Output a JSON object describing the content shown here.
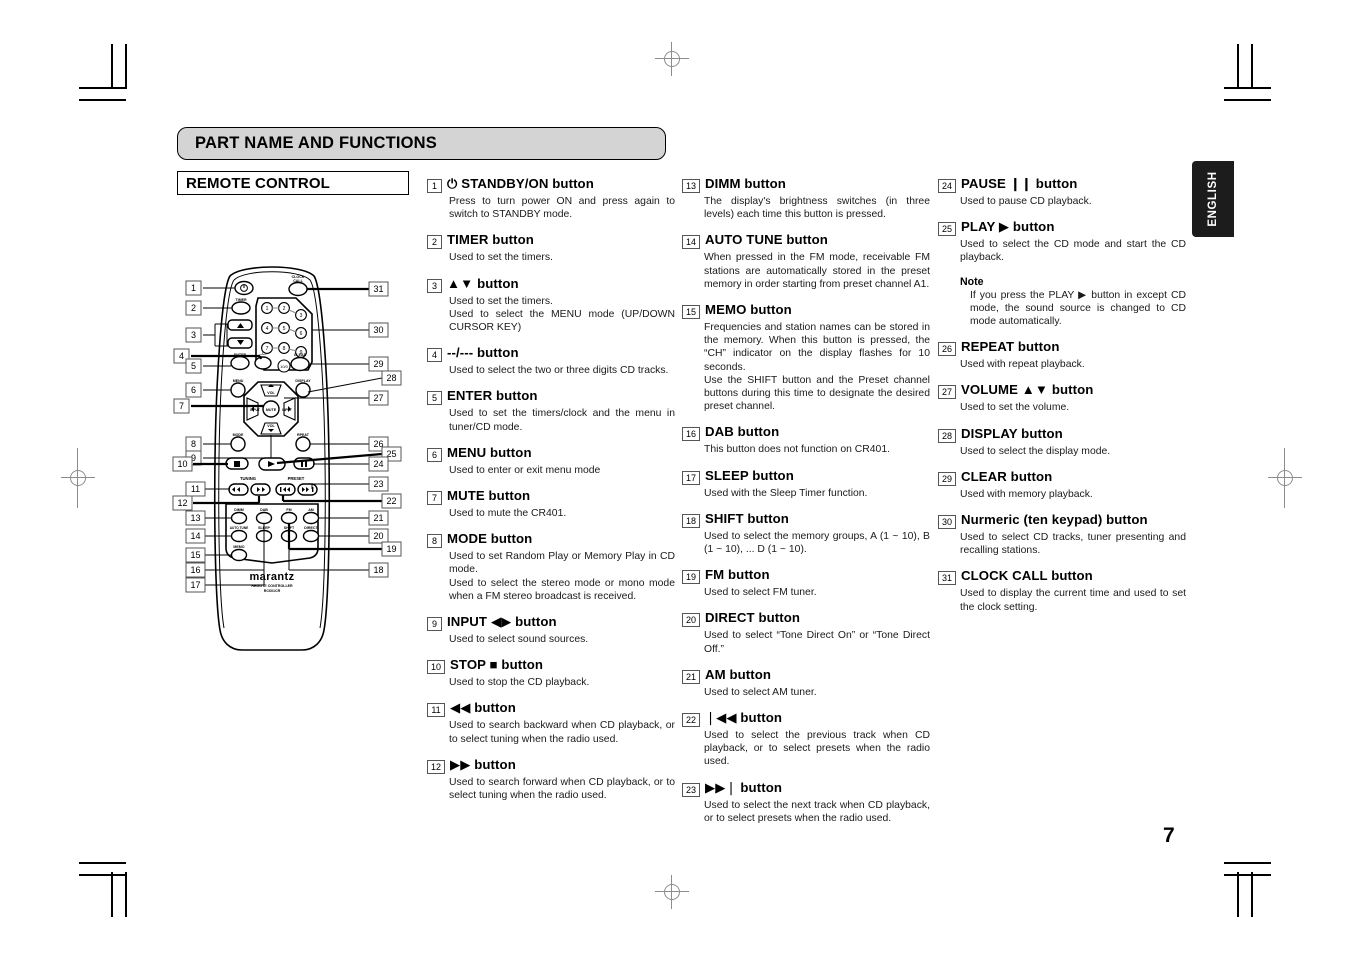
{
  "page": {
    "section_banner": "PART NAME AND FUNCTIONS",
    "subsection": "REMOTE CONTROL",
    "language_tab": "ENGLISH",
    "page_number": "7"
  },
  "remote": {
    "brand": "marantz",
    "sub_brand": "REMOTE CONTROLLER",
    "model": "RC601CR",
    "button_labels": {
      "clock_call": "CLOCK\nCALL",
      "timer": "TIMER",
      "enter": "ENTER",
      "menu": "MENU",
      "display": "DISPLAY",
      "clear": "CLEAR",
      "mode": "MODE",
      "repeat": "RPEAT",
      "mute": "MUTE",
      "vol_up": "VOL",
      "vol_down": "VOL",
      "input_left": "INPUT",
      "input_right": "INPUT",
      "tuning": "TUNING",
      "preset": "PRESET",
      "dimm": "DIMM",
      "dab": "DAB",
      "fm": "FM",
      "am": "AM",
      "auto_tune": "AUTO TUNE",
      "sleep": "SLEEP",
      "shift": "SHIFT",
      "direct": "DIRECT",
      "memo": "MEMO",
      "dashes": "--/---",
      "ten": "10/0"
    },
    "keypad": [
      "1",
      "2",
      "3",
      "4",
      "5",
      "6",
      "7",
      "8",
      "9"
    ],
    "callouts_left": [
      "1",
      "2",
      "3",
      "4",
      "5",
      "6",
      "7",
      "8",
      "9",
      "10",
      "11",
      "12",
      "13",
      "14",
      "15",
      "16",
      "17"
    ],
    "callouts_right": [
      "31",
      "30",
      "29",
      "28",
      "27",
      "26",
      "25",
      "24",
      "23",
      "22",
      "21",
      "20",
      "19",
      "18"
    ]
  },
  "entries": [
    {
      "num": "1",
      "glyph": "⏻ ",
      "title": "STANDBY/ON button",
      "desc": "Press to turn power ON and press again to switch to STANDBY mode."
    },
    {
      "num": "2",
      "glyph": "",
      "title": "TIMER button",
      "desc": "Used to set the timers."
    },
    {
      "num": "3",
      "glyph": "▲▼ ",
      "title": "button",
      "desc": "Used to set the timers.\nUsed to select the MENU mode (UP/DOWN CURSOR KEY)"
    },
    {
      "num": "4",
      "glyph": "--/--- ",
      "title": "button",
      "desc": "Used to select the two or three digits CD tracks."
    },
    {
      "num": "5",
      "glyph": "",
      "title": "ENTER button",
      "desc": "Used to set the timers/clock and the menu in tuner/CD mode."
    },
    {
      "num": "6",
      "glyph": "",
      "title": "MENU button",
      "desc": "Used to enter or exit menu mode"
    },
    {
      "num": "7",
      "glyph": "",
      "title": "MUTE button",
      "desc": "Used to mute the CR401."
    },
    {
      "num": "8",
      "glyph": "",
      "title": "MODE button",
      "desc": "Used to set Random Play or Memory Play in CD mode.\nUsed to select the stereo mode or mono mode when a FM stereo broadcast is received."
    },
    {
      "num": "9",
      "glyph": "INPUT ◀▶ ",
      "title": "button",
      "desc": "Used to select sound sources."
    },
    {
      "num": "10",
      "glyph": "STOP ■ ",
      "title": "button",
      "desc": "Used to stop the CD playback."
    },
    {
      "num": "11",
      "glyph": "◀◀ ",
      "title": "button",
      "desc": "Used to search backward when CD playback, or to select tuning when the radio used."
    },
    {
      "num": "12",
      "glyph": "▶▶ ",
      "title": "button",
      "desc": "Used to search forward when CD playback, or to select tuning when the radio used."
    },
    {
      "num": "13",
      "glyph": "",
      "title": "DIMM button",
      "desc": "The display's brightness switches (in three levels) each time this button is pressed."
    },
    {
      "num": "14",
      "glyph": "",
      "title": "AUTO TUNE button",
      "desc": "When pressed in the FM mode, receivable FM stations are automatically stored in the preset memory in order starting from preset channel A1."
    },
    {
      "num": "15",
      "glyph": "",
      "title": "MEMO button",
      "desc": "Frequencies and station names can be stored in the memory. When this button is pressed, the “CH” indicator on the display flashes for 10 seconds.\nUse the SHIFT button and the Preset channel buttons during this time to designate the desired preset channel."
    },
    {
      "num": "16",
      "glyph": "",
      "title": "DAB button",
      "desc": "This button does not function on CR401."
    },
    {
      "num": "17",
      "glyph": "",
      "title": "SLEEP button",
      "desc": "Used with the Sleep Timer function."
    },
    {
      "num": "18",
      "glyph": "",
      "title": "SHIFT button",
      "desc": "Used to select the memory groups, A (1 ~ 10), B (1 ~ 10), ... D (1 ~ 10)."
    },
    {
      "num": "19",
      "glyph": "",
      "title": "FM button",
      "desc": "Used to select FM tuner."
    },
    {
      "num": "20",
      "glyph": "",
      "title": "DIRECT button",
      "desc": "Used to select “Tone Direct On” or “Tone Direct Off.”"
    },
    {
      "num": "21",
      "glyph": "",
      "title": "AM button",
      "desc": "Used to select AM tuner."
    },
    {
      "num": "22",
      "glyph": "❘◀◀ ",
      "title": "button",
      "desc": "Used to select the previous track when CD playback, or to select presets when the radio used."
    },
    {
      "num": "23",
      "glyph": "▶▶❘ ",
      "title": "button",
      "desc": "Used to select the next track when CD playback, or to select presets when the radio used."
    },
    {
      "num": "24",
      "glyph": "PAUSE ❙❙ ",
      "title": "button",
      "desc": "Used to pause CD playback."
    },
    {
      "num": "25",
      "glyph": "PLAY ▶ ",
      "title": "button",
      "desc": "Used to select the CD mode and start the CD playback.",
      "note_title": "Note",
      "note_body": "If you press the PLAY ▶ button in except CD mode, the sound source is changed to CD mode automatically."
    },
    {
      "num": "26",
      "glyph": "",
      "title": "REPEAT button",
      "desc": "Used with repeat playback."
    },
    {
      "num": "27",
      "glyph": "VOLUME ▲▼ ",
      "title": "button",
      "desc": "Used to set the volume."
    },
    {
      "num": "28",
      "glyph": "",
      "title": "DISPLAY button",
      "desc": "Used to select the display mode."
    },
    {
      "num": "29",
      "glyph": "",
      "title": "CLEAR button",
      "desc": "Used with memory playback."
    },
    {
      "num": "30",
      "glyph": "",
      "title": "Nurmeric (ten keypad) button",
      "desc": "Used to select CD tracks, tuner presenting and recalling stations."
    },
    {
      "num": "31",
      "glyph": "",
      "title": "CLOCK CALL button",
      "desc": "Used to display the current time and used to set the clock setting."
    }
  ],
  "colors": {
    "banner_fill": "#d4d4d4",
    "tab_fill": "#1c1c1c",
    "line": "#000000",
    "mark": "#8c8c8c"
  }
}
